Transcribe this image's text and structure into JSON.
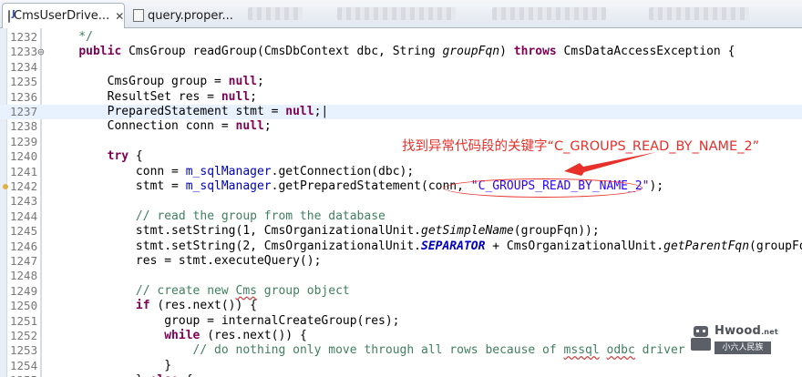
{
  "tabs": [
    {
      "label": "CmsUserDrive...",
      "active": true,
      "close": "✕"
    },
    {
      "label": "query.proper...",
      "active": false
    }
  ],
  "code_lines": [
    {
      "num": "1232",
      "segs": [
        {
          "t": "    */",
          "c": "cm"
        }
      ]
    },
    {
      "num": "1233⊖",
      "segs": [
        {
          "t": "    "
        },
        {
          "t": "public",
          "c": "kw"
        },
        {
          "t": " CmsGroup readGroup(CmsDbContext dbc, String "
        },
        {
          "t": "groupFqn",
          "c": "it"
        },
        {
          "t": ") "
        },
        {
          "t": "throws",
          "c": "kw"
        },
        {
          "t": " CmsDataAccessException {"
        }
      ]
    },
    {
      "num": "1234",
      "segs": []
    },
    {
      "num": "1235",
      "segs": [
        {
          "t": "        CmsGroup group = "
        },
        {
          "t": "null",
          "c": "kw"
        },
        {
          "t": ";"
        }
      ]
    },
    {
      "num": "1236",
      "segs": [
        {
          "t": "        ResultSet res = "
        },
        {
          "t": "null",
          "c": "kw"
        },
        {
          "t": ";"
        }
      ]
    },
    {
      "num": "1237",
      "hl": true,
      "segs": [
        {
          "t": "        PreparedStatement stmt = "
        },
        {
          "t": "null",
          "c": "kw"
        },
        {
          "t": ";|"
        }
      ]
    },
    {
      "num": "1238",
      "segs": [
        {
          "t": "        Connection conn = "
        },
        {
          "t": "null",
          "c": "kw"
        },
        {
          "t": ";"
        }
      ]
    },
    {
      "num": "1239",
      "segs": []
    },
    {
      "num": "1240",
      "segs": [
        {
          "t": "        "
        },
        {
          "t": "try",
          "c": "kw"
        },
        {
          "t": " {"
        }
      ]
    },
    {
      "num": "1241",
      "segs": [
        {
          "t": "            conn = "
        },
        {
          "t": "m_sqlManager",
          "c": "fld"
        },
        {
          "t": ".getConnection(dbc);"
        }
      ]
    },
    {
      "num": "1242",
      "mark": true,
      "segs": [
        {
          "t": "            stmt = "
        },
        {
          "t": "m_sqlManager",
          "c": "fld"
        },
        {
          "t": ".getPreparedStatement(conn, "
        },
        {
          "t": "\"C_GROUPS_READ_BY_NAME_2\"",
          "c": "st"
        },
        {
          "t": ");"
        }
      ]
    },
    {
      "num": "1243",
      "segs": []
    },
    {
      "num": "1244",
      "segs": [
        {
          "t": "            "
        },
        {
          "t": "// read the group from the database",
          "c": "cm"
        }
      ]
    },
    {
      "num": "1245",
      "segs": [
        {
          "t": "            stmt.setString(1, CmsOrganizationalUnit."
        },
        {
          "t": "getSimpleName",
          "c": "it"
        },
        {
          "t": "(groupFqn));"
        }
      ]
    },
    {
      "num": "1246",
      "segs": [
        {
          "t": "            stmt.setString(2, CmsOrganizationalUnit."
        },
        {
          "t": "SEPARATOR",
          "c": "sf"
        },
        {
          "t": " + CmsOrganizationalUnit."
        },
        {
          "t": "getParentFqn",
          "c": "it"
        },
        {
          "t": "(groupFqn));"
        }
      ]
    },
    {
      "num": "1247",
      "segs": [
        {
          "t": "            res = stmt.executeQuery();"
        }
      ]
    },
    {
      "num": "1248",
      "segs": []
    },
    {
      "num": "1249",
      "segs": [
        {
          "t": "            "
        },
        {
          "t": "// create new ",
          "c": "cm"
        },
        {
          "t": "Cms",
          "c": "cm uw"
        },
        {
          "t": " group object",
          "c": "cm"
        }
      ]
    },
    {
      "num": "1250",
      "segs": [
        {
          "t": "            "
        },
        {
          "t": "if",
          "c": "kw"
        },
        {
          "t": " (res.next()) {"
        }
      ]
    },
    {
      "num": "1251",
      "segs": [
        {
          "t": "                group = internalCreateGroup(res);"
        }
      ]
    },
    {
      "num": "1252",
      "segs": [
        {
          "t": "                "
        },
        {
          "t": "while",
          "c": "kw"
        },
        {
          "t": " (res.next()) {"
        }
      ]
    },
    {
      "num": "1253",
      "segs": [
        {
          "t": "                    "
        },
        {
          "t": "// do nothing only move through all rows because of ",
          "c": "cm"
        },
        {
          "t": "mssql",
          "c": "cm uw"
        },
        {
          "t": " ",
          "c": "cm"
        },
        {
          "t": "odbc",
          "c": "cm uw"
        },
        {
          "t": " driver",
          "c": "cm"
        }
      ]
    },
    {
      "num": "1254",
      "segs": [
        {
          "t": "                }"
        }
      ]
    },
    {
      "num": "1255",
      "segs": [
        {
          "t": "            } "
        },
        {
          "t": "else",
          "c": "kw"
        },
        {
          "t": " {"
        }
      ]
    }
  ],
  "annotation": {
    "text": "找到异常代码段的关键字“C_GROUPS_READ_BY_NAME_2”",
    "color": "#e8302a"
  },
  "watermark": {
    "brand": "Hwood",
    "brand_suffix": ".net",
    "sub": "小六人民族"
  },
  "colors": {
    "keyword": "#7f0055",
    "comment": "#3f7f5f",
    "string": "#2a00ff",
    "field": "#0000c0",
    "current_line": "#e8f2fe"
  }
}
